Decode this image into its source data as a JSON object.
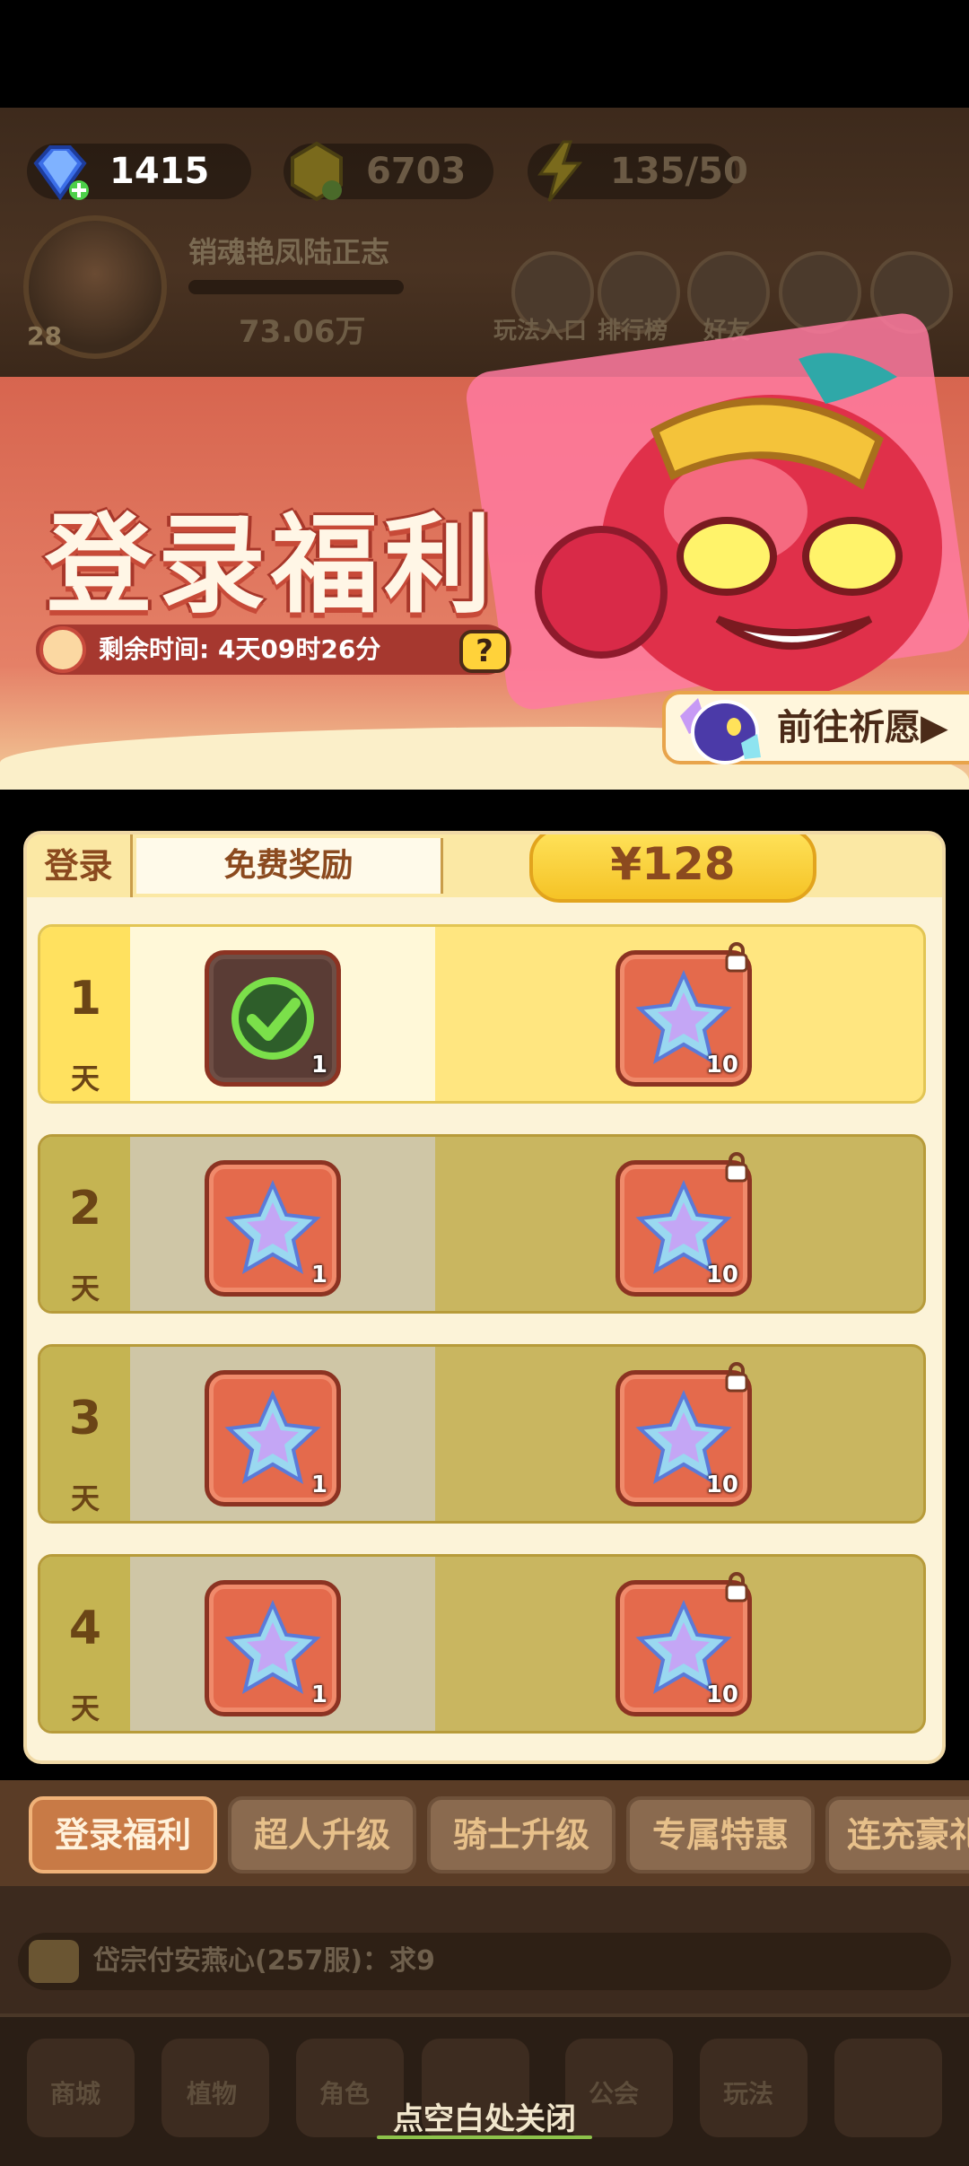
{
  "hud": {
    "gems": "1415",
    "coins": "6703",
    "energy": "135/50",
    "level": "28",
    "player_name": "销魂艳凤陆正志",
    "power": "73.06万",
    "hud_buttons": [
      "玩法入口",
      "排行榜",
      "好友"
    ]
  },
  "banner": {
    "title": "登录福利",
    "time_remaining": "剩余时间: 4天09时26分",
    "help_label": "?",
    "wish_button": "前往祈愿▶"
  },
  "rewards": {
    "col_login": "登录",
    "col_free": "免费奖励",
    "col_paid": "¥128",
    "day_unit": "天",
    "rows": [
      {
        "day": "1",
        "free_qty": "1",
        "paid_qty": "10",
        "free_claimed": true
      },
      {
        "day": "2",
        "free_qty": "1",
        "paid_qty": "10",
        "free_claimed": false
      },
      {
        "day": "3",
        "free_qty": "1",
        "paid_qty": "10",
        "free_claimed": false
      },
      {
        "day": "4",
        "free_qty": "1",
        "paid_qty": "10",
        "free_claimed": false
      }
    ]
  },
  "tabs": [
    "登录福利",
    "超人升级",
    "骑士升级",
    "专属特惠",
    "连充豪礼"
  ],
  "active_tab": 0,
  "chat": {
    "message": "岱宗付安燕心(257服)：求9"
  },
  "nav": [
    "商城",
    "植物",
    "角色",
    "",
    "公会",
    "玩法",
    ""
  ],
  "close_hint": "点空白处关闭",
  "colors": {
    "accent": "#c87a46",
    "banner": "#e58067",
    "gold": "#f5c326"
  }
}
